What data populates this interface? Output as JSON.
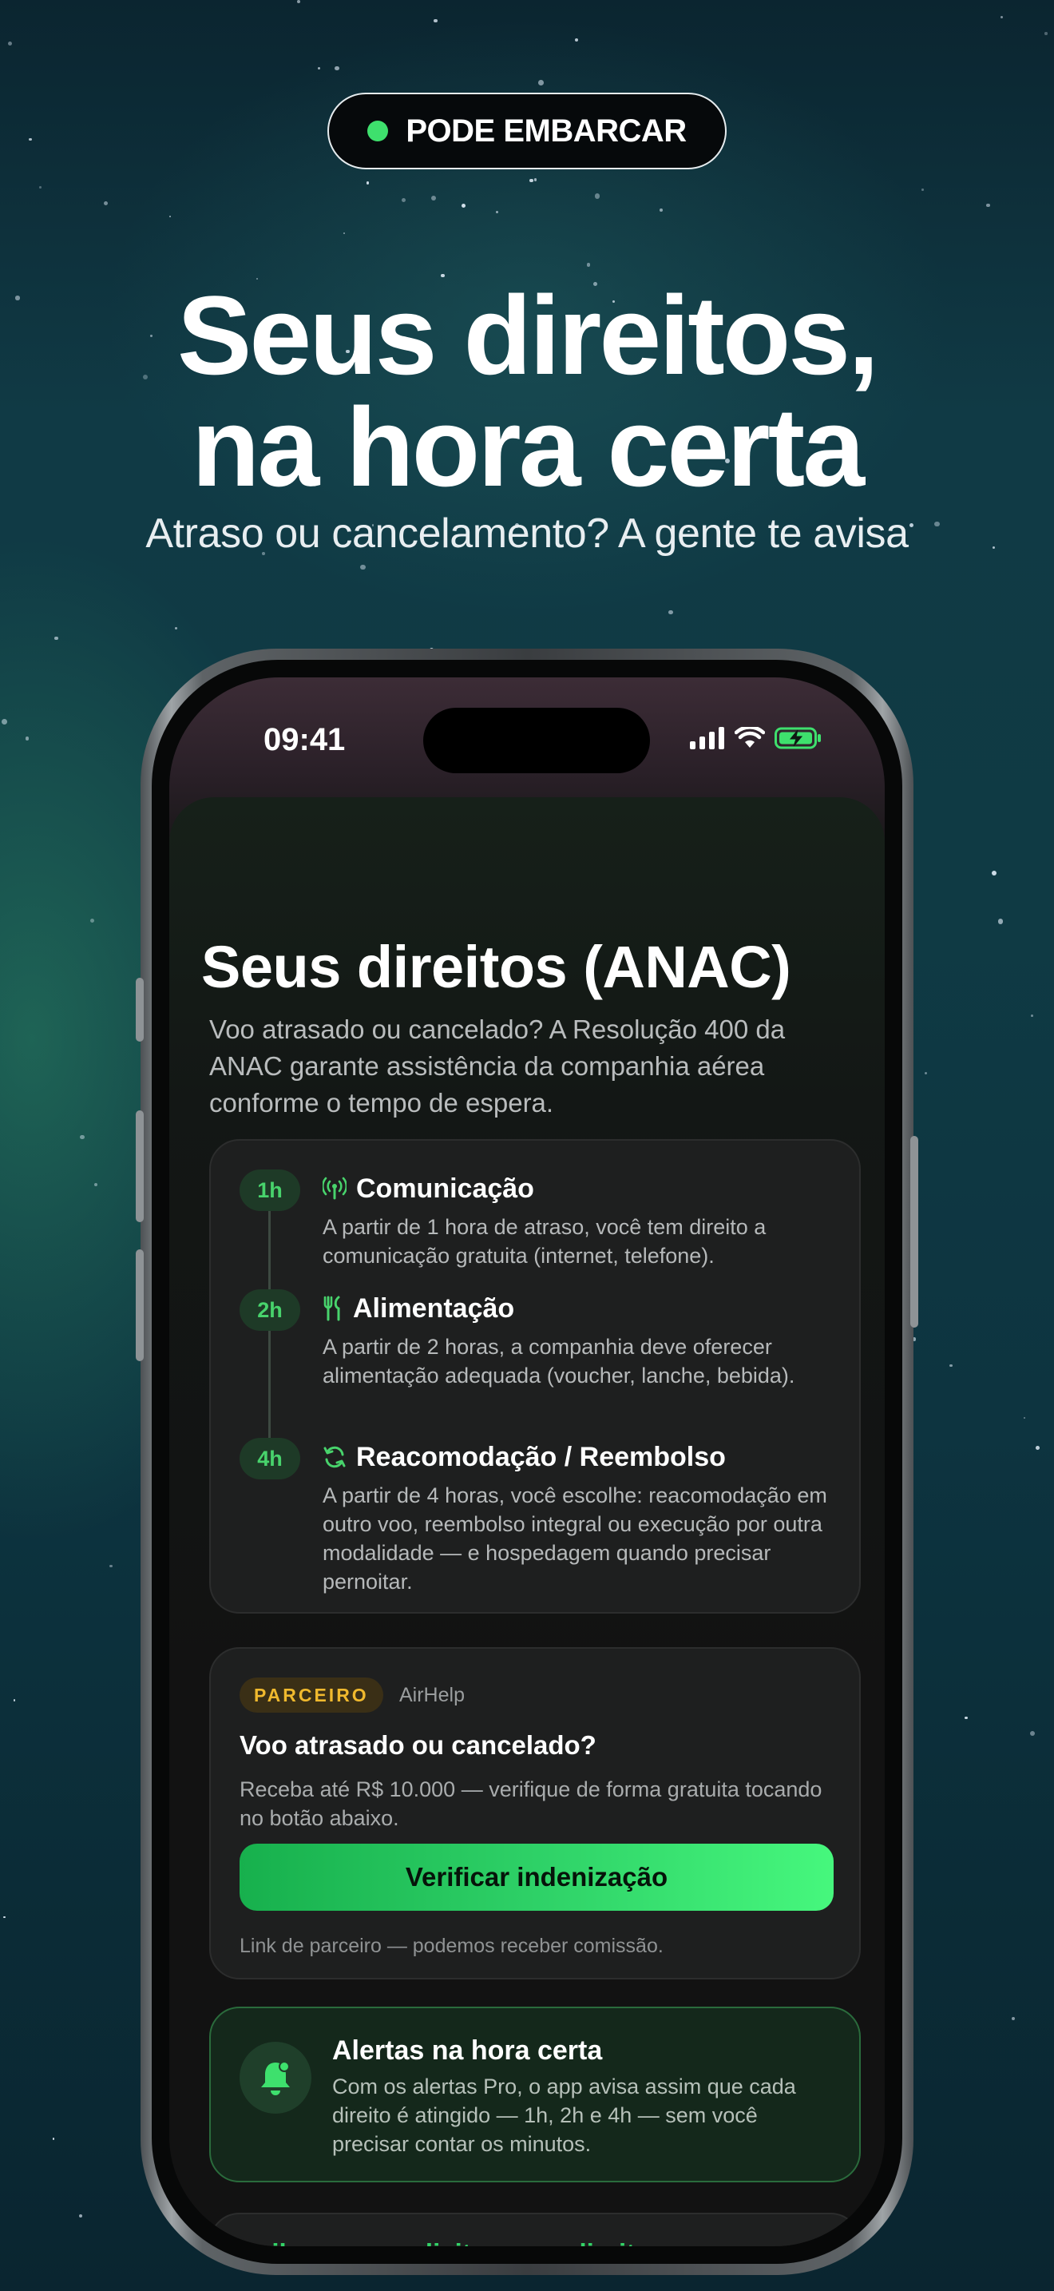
{
  "badge": {
    "label": "PODE EMBARCAR",
    "dot_color": "#3ee06d"
  },
  "hero": {
    "title_line1": "Seus direitos,",
    "title_line2": "na hora certa",
    "subtitle": "Atraso ou cancelamento? A gente te avisa"
  },
  "status_bar": {
    "time": "09:41",
    "icons": [
      "signal-icon",
      "wifi-icon",
      "battery-charging-icon"
    ]
  },
  "screen": {
    "title": "Seus direitos (ANAC)",
    "intro": "Voo atrasado ou cancelado? A Resolução 400 da ANAC garante assistência da companhia aérea conforme o tempo de espera.",
    "timeline": [
      {
        "badge": "1h",
        "icon": "antenna-icon",
        "title": "Comunicação",
        "desc": "A partir de 1 hora de atraso, você tem direito a comunicação gratuita (internet, telefone)."
      },
      {
        "badge": "2h",
        "icon": "fork-knife-icon",
        "title": "Alimentação",
        "desc": "A partir de 2 horas, a companhia deve oferecer alimentação adequada (voucher, lanche, bebida)."
      },
      {
        "badge": "4h",
        "icon": "refresh-icon",
        "title": "Reacomodação / Reembolso",
        "desc": "A partir de 4 horas, você escolhe: reacomodação em outro voo, reembolso integral ou execução por outra modalidade — e hospedagem quando precisar pernoitar."
      }
    ],
    "partner": {
      "tag": "PARCEIRO",
      "name": "AirHelp",
      "headline": "Voo atrasado ou cancelado?",
      "desc": "Receba até R$ 10.000 — verifique de forma gratuita tocando no botão abaixo.",
      "cta": "Verificar indenização",
      "disclaimer": "Link de parceiro — podemos receber comissão."
    },
    "alerts": {
      "icon": "bell-icon",
      "title": "Alertas na hora certa",
      "desc": "Com os alertas Pro, o app avisa assim que cada direito é atingido — 1h, 2h e 4h — sem você precisar contar os minutos."
    },
    "learn_more": {
      "label": "Saiba como solicitar seus direitos",
      "icon": "external-link-icon"
    }
  },
  "colors": {
    "accent_green": "#33d367",
    "partner_yellow": "#f0b92e",
    "background": "#0f3a44"
  }
}
